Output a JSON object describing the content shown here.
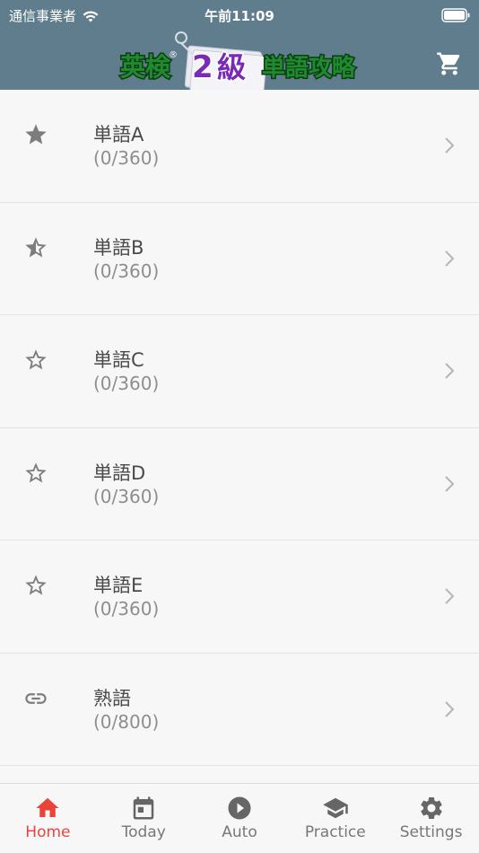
{
  "status_bar": {
    "carrier": "通信事業者",
    "time": "午前11:09"
  },
  "nav": {
    "logo_parts": [
      "英検",
      "2",
      "級",
      "単語攻略"
    ],
    "logo_registered": "®",
    "cart_icon": "cart-icon"
  },
  "list": [
    {
      "icon": "star-filled-icon",
      "title": "単語A",
      "progress": "(0/360)"
    },
    {
      "icon": "star-half-icon",
      "title": "単語B",
      "progress": "(0/360)"
    },
    {
      "icon": "star-outline-icon",
      "title": "単語C",
      "progress": "(0/360)"
    },
    {
      "icon": "star-outline-icon",
      "title": "単語D",
      "progress": "(0/360)"
    },
    {
      "icon": "star-outline-icon",
      "title": "単語E",
      "progress": "(0/360)"
    },
    {
      "icon": "link-icon",
      "title": "熟語",
      "progress": "(0/800)"
    }
  ],
  "tabs": [
    {
      "label": "Home",
      "icon": "home-icon",
      "active": true
    },
    {
      "label": "Today",
      "icon": "calendar-icon",
      "active": false
    },
    {
      "label": "Auto",
      "icon": "play-circle-icon",
      "active": false
    },
    {
      "label": "Practice",
      "icon": "graduation-cap-icon",
      "active": false
    },
    {
      "label": "Settings",
      "icon": "gear-icon",
      "active": false
    }
  ],
  "colors": {
    "header": "#5f7d8c",
    "active_tab": "#e8443a",
    "inactive_tab": "#777777",
    "logo_green": "#1f8a2e",
    "logo_purple": "#7a2bb5"
  }
}
